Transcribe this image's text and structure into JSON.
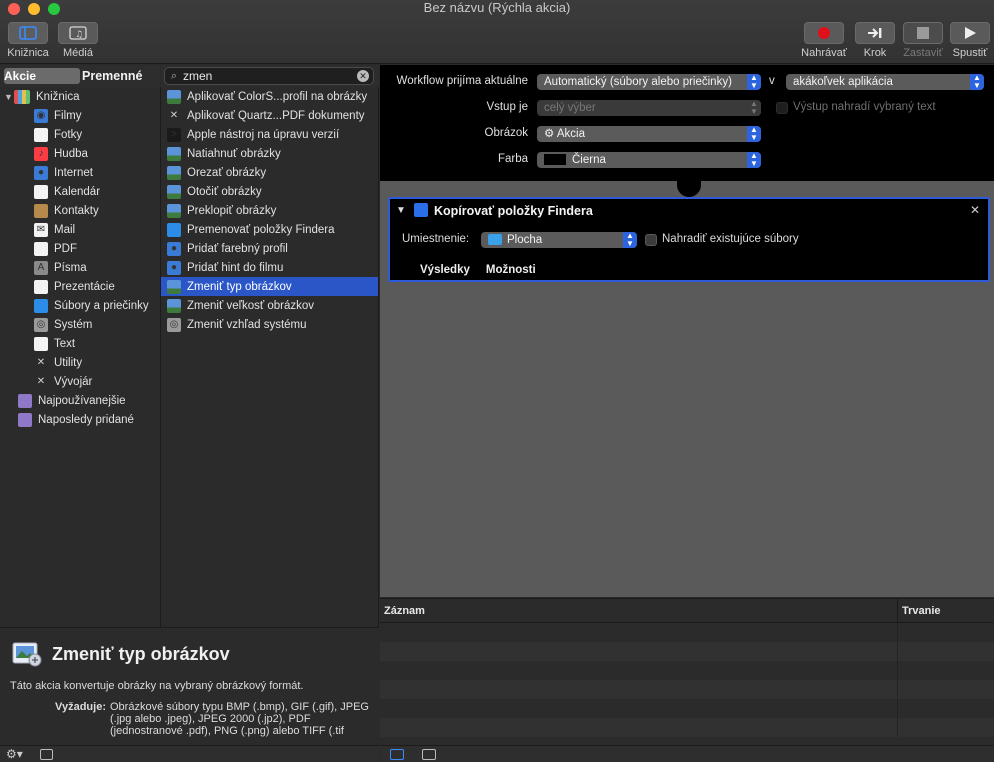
{
  "window": {
    "title": "Bez názvu (Rýchla akcia)"
  },
  "toolbar": {
    "library_label": "Knižnica",
    "media_label": "Médiá",
    "record_label": "Nahrávať",
    "step_label": "Krok",
    "stop_label": "Zastaviť",
    "run_label": "Spustiť"
  },
  "library": {
    "tab_actions": "Akcie",
    "tab_variables": "Premenné",
    "root_label": "Knižnica",
    "items": [
      {
        "label": "Filmy",
        "icon": "movies-icon"
      },
      {
        "label": "Fotky",
        "icon": "photos-icon"
      },
      {
        "label": "Hudba",
        "icon": "music-icon"
      },
      {
        "label": "Internet",
        "icon": "internet-icon"
      },
      {
        "label": "Kalendár",
        "icon": "calendar-icon"
      },
      {
        "label": "Kontakty",
        "icon": "contacts-icon"
      },
      {
        "label": "Mail",
        "icon": "mail-icon"
      },
      {
        "label": "PDF",
        "icon": "pdf-icon"
      },
      {
        "label": "Písma",
        "icon": "fonts-icon"
      },
      {
        "label": "Prezentácie",
        "icon": "presentations-icon"
      },
      {
        "label": "Súbory a priečinky",
        "icon": "finder-icon"
      },
      {
        "label": "Systém",
        "icon": "system-icon"
      },
      {
        "label": "Text",
        "icon": "text-icon"
      },
      {
        "label": "Utility",
        "icon": "utilities-icon"
      },
      {
        "label": "Vývojár",
        "icon": "developer-icon"
      }
    ],
    "smart_groups": [
      {
        "label": "Najpoužívanejšie",
        "icon": "smart-folder-icon"
      },
      {
        "label": "Naposledy pridané",
        "icon": "smart-folder-icon"
      }
    ]
  },
  "search": {
    "value": "zmen"
  },
  "actions": [
    {
      "label": "Aplikovať ColorS...profil na obrázky",
      "icon": "image-icon",
      "selected": false
    },
    {
      "label": "Aplikovať Quartz...PDF dokumenty",
      "icon": "tools-icon",
      "selected": false
    },
    {
      "label": "Apple nástroj na úpravu verzií",
      "icon": "terminal-icon",
      "selected": false
    },
    {
      "label": "Natiahnuť obrázky",
      "icon": "image-icon",
      "selected": false
    },
    {
      "label": "Orezať obrázky",
      "icon": "image-icon",
      "selected": false
    },
    {
      "label": "Otočiť obrázky",
      "icon": "image-icon",
      "selected": false
    },
    {
      "label": "Preklopiť obrázky",
      "icon": "image-icon",
      "selected": false
    },
    {
      "label": "Premenovať položky Findera",
      "icon": "finder-icon",
      "selected": false
    },
    {
      "label": "Pridať farebný profil",
      "icon": "colorsync-icon",
      "selected": false
    },
    {
      "label": "Pridať hint do filmu",
      "icon": "quicktime-icon",
      "selected": false
    },
    {
      "label": "Zmeniť typ obrázkov",
      "icon": "image-icon",
      "selected": true
    },
    {
      "label": "Zmeniť veľkosť obrázkov",
      "icon": "image-icon",
      "selected": false
    },
    {
      "label": "Zmeniť vzhľad systému",
      "icon": "system-icon",
      "selected": false
    }
  ],
  "description": {
    "title": "Zmeniť typ obrázkov",
    "text": "Táto akcia konvertuje obrázky na vybraný obrázkový formát.",
    "requires_label": "Vyžaduje:",
    "requires_text": "Obrázkové súbory typu BMP (.bmp), GIF (.gif), JPEG (.jpg alebo .jpeg), JPEG 2000 (.jp2), PDF (jednostranové .pdf), PNG (.png) alebo TIFF (.tif"
  },
  "workflow": {
    "receives_label": "Workflow prijíma aktuálne",
    "receives_value": "Automatický (súbory alebo priečinky)",
    "in_label": "v",
    "app_value": "akákoľvek aplikácia",
    "input_label": "Vstup je",
    "input_value": "celý výber",
    "replace_label": "Výstup nahradí vybraný text",
    "image_label": "Obrázok",
    "image_value": "Akcia",
    "color_label": "Farba",
    "color_value": "Čierna"
  },
  "action_card": {
    "title": "Kopírovať položky Findera",
    "location_label": "Umiestnenie:",
    "location_value": "Plocha",
    "replace_label": "Nahradiť existujúce súbory",
    "tab_results": "Výsledky",
    "tab_options": "Možnosti"
  },
  "log": {
    "col_record": "Záznam",
    "col_duration": "Trvanie"
  },
  "colors": {
    "selection": "#2a56c8",
    "accent_chevron": "#2c64e0",
    "record_red": "#e0101a"
  }
}
